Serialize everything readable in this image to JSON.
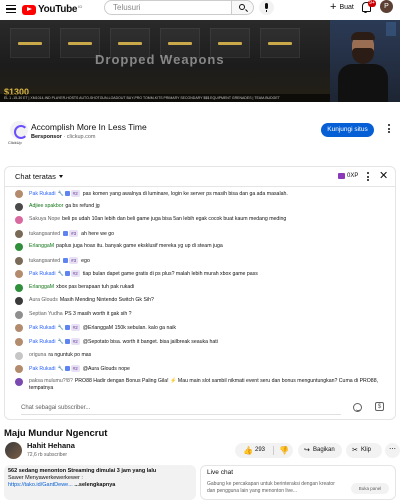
{
  "header": {
    "logo_text": "YouTube",
    "logo_region": "ID",
    "search_placeholder": "Telusuri",
    "create_label": "Buat",
    "notification_count": "9+",
    "avatar_initial": "P"
  },
  "video": {
    "hud_title": "Dropped Weapons",
    "money": "$1300",
    "hud_strip": "EL 1  -15-30 ET  |  XM1014-IND   PLAYER-HOSTS   AUTO-SHOTGUN-LOADOUT   BUY-PRO   TOMM-KITS   PRIMARY   SECONDARY   $$$   EQUIPMENT   GRENADES   |   TEAM-BUDGET"
  },
  "ad": {
    "logo_caption": "ClickUp",
    "title": "Accomplish More In Less Time",
    "sponsor_label": "Bersponsor",
    "sponsor_domain": "clickup.com",
    "cta": "Kunjungi situs"
  },
  "chat": {
    "header_title": "Chat teratas",
    "xp_label": "0XP",
    "input_placeholder": "Chat sebagai subscriber...",
    "messages": [
      {
        "name": "Pak Rukadi",
        "color": "blue",
        "badge": "#2",
        "text": "pas komen yang awalnya di luminare, login ke server ps masih bisa dan ga ada masalah.",
        "avatar": "#b38b6d"
      },
      {
        "name": "Adjiee spakbor",
        "color": "green",
        "badge": "",
        "text": "ga bs refund jg",
        "avatar": "#4a4a4a"
      },
      {
        "name": "Sakuya Nope",
        "color": "grey",
        "badge": "",
        "text": "beli ps udah 10an lebih dan beli game juga bisa 5an lebih egak cocok buat kaum medang meding",
        "avatar": "#d86aa0"
      },
      {
        "name": "tukangsanted",
        "color": "grey",
        "badge": "#3",
        "text": "ah here we go",
        "avatar": "#7a6a58"
      },
      {
        "name": "ErlanggaM",
        "color": "green",
        "badge": "",
        "text": "paplus juga hoax itu. banyak game eksklusif mereka yg up di steam juga",
        "avatar": "#2f8f3a"
      },
      {
        "name": "tukangsanted",
        "color": "grey",
        "badge": "#3",
        "text": "ego",
        "avatar": "#7a6a58"
      },
      {
        "name": "Pak Rukadi",
        "color": "blue",
        "badge": "#2",
        "text": "tiap bulan dapet game gratis di ps plus? malah lebih murah xbox game pass",
        "avatar": "#b38b6d"
      },
      {
        "name": "ErlanggaM",
        "color": "green",
        "badge": "",
        "text": "xbox pas berapaan tuh pak rukadi",
        "avatar": "#2f8f3a"
      },
      {
        "name": "Aura Glouds",
        "color": "grey",
        "badge": "",
        "text": "Masih Mending Nintendo Switch Gk Sih?",
        "avatar": "#3a3a3a"
      },
      {
        "name": "Septian Yudha",
        "color": "grey",
        "badge": "",
        "text": "PS 3 masih worth it gak sih ?",
        "avatar": "#8f8f8f"
      },
      {
        "name": "Pak Rukadi",
        "color": "blue",
        "badge": "#2",
        "text": "@ErlanggaM 150k sebulan. kalo ga naik",
        "avatar": "#b38b6d"
      },
      {
        "name": "Pak Rukadi",
        "color": "blue",
        "badge": "#2",
        "text": "@Sepotato bisa. worth it banget. bisa jailbreak seauka hati",
        "avatar": "#b38b6d"
      },
      {
        "name": "origuna",
        "color": "grey",
        "badge": "",
        "text": "ra nguntuk po mas",
        "avatar": "#c6c6c6"
      },
      {
        "name": "Pak Rukadi",
        "color": "blue",
        "badge": "#2",
        "text": "@Aura Glouds nope",
        "avatar": "#b38b6d"
      },
      {
        "name": "paksa mulumu?!8?",
        "color": "grey",
        "badge": "",
        "text": "PRO88 Hadir dengan Bonus Paling Gila! ⚡ Mau main slot sambil nikmati event seru dan bonus menguntungkan? Cuma di PRO88, tempatnya",
        "avatar": "#7a4ab0"
      }
    ]
  },
  "info": {
    "title": "Maju Mundur Ngencrut",
    "channel": "Hahit Hehana",
    "subscribers": "72,6 rb subscriber",
    "likes": "293",
    "share_label": "Bagikan",
    "clip_label": "Klip",
    "desc_stats": "562 sedang menonton  Streaming dimulai 3 jam yang lalu",
    "desc_line2": "Sawer Menyawerkewerkewer :",
    "desc_link": "https://tako.id/GantDewe...",
    "desc_more": "...selengkapnya",
    "live_title": "Live chat",
    "live_body": "Gabung ke percakapan untuk berinteraksi dengan kreator dan pengguna lain yang menonton live...",
    "live_button": "Buka panel"
  }
}
